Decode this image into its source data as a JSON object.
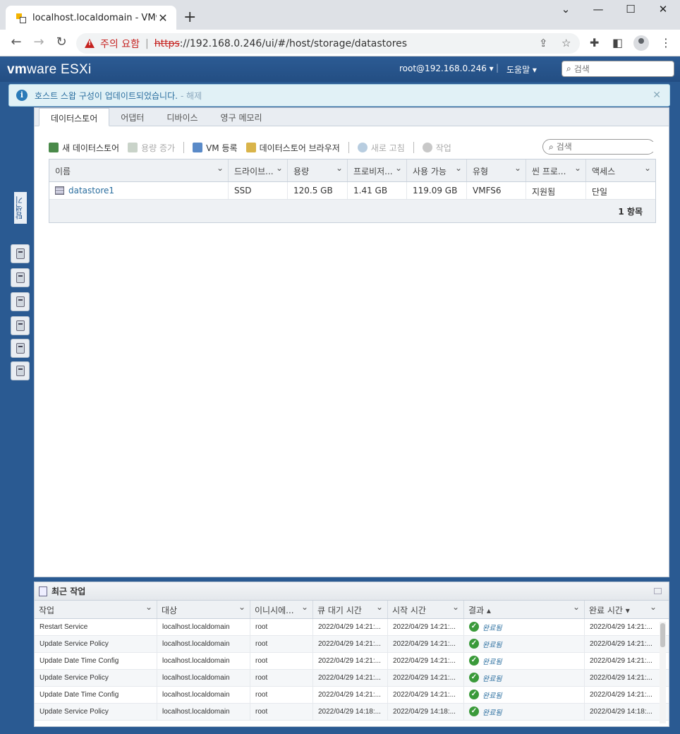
{
  "browser": {
    "tab_title": "localhost.localdomain - VMware",
    "security_warning": "주의 요함",
    "url_protocol": "https",
    "url_rest": "://192.168.0.246/ui/#/host/storage/datastores"
  },
  "header": {
    "logo_vm": "vm",
    "logo_ware": "ware",
    "logo_esxi": "ESXi",
    "user": "root@192.168.0.246 ▾",
    "separator": "|",
    "help": "도움말 ▾",
    "search_placeholder": "검색"
  },
  "notice": {
    "text": "호스트 스왑 구성이 업데이트되었습니다.",
    "link": "- 해제"
  },
  "sidebar": {
    "navigator_label": "탐색기"
  },
  "tabs": [
    "데이터스토어",
    "어댑터",
    "디바이스",
    "영구 메모리"
  ],
  "actions": {
    "new_datastore": "새 데이터스토어",
    "increase_capacity": "용량 증가",
    "register_vm": "VM 등록",
    "datastore_browser": "데이터스토어 브라우저",
    "refresh": "새로 고침",
    "tasks": "작업",
    "search_placeholder": "검색"
  },
  "datastore_grid": {
    "columns": [
      "이름",
      "드라이브...",
      "용량",
      "프로비저...",
      "사용 가능",
      "유형",
      "씬 프로...",
      "액세스"
    ],
    "rows": [
      [
        "datastore1",
        "SSD",
        "120.5 GB",
        "1.41 GB",
        "119.09 GB",
        "VMFS6",
        "지원됨",
        "단일"
      ]
    ],
    "footer": "1 항목"
  },
  "recent_tasks": {
    "title": "최근 작업",
    "columns": [
      "작업",
      "대상",
      "이니시에...",
      "큐 대기 시간",
      "시작 시간",
      "결과 ▴",
      "완료 시간 ▾"
    ],
    "rows": [
      [
        "Restart Service",
        "localhost.localdomain",
        "root",
        "2022/04/29 14:21:...",
        "2022/04/29 14:21:...",
        "완료됨",
        "2022/04/29 14:21:..."
      ],
      [
        "Update Service Policy",
        "localhost.localdomain",
        "root",
        "2022/04/29 14:21:...",
        "2022/04/29 14:21:...",
        "완료됨",
        "2022/04/29 14:21:..."
      ],
      [
        "Update Date Time Config",
        "localhost.localdomain",
        "root",
        "2022/04/29 14:21:...",
        "2022/04/29 14:21:...",
        "완료됨",
        "2022/04/29 14:21:..."
      ],
      [
        "Update Service Policy",
        "localhost.localdomain",
        "root",
        "2022/04/29 14:21:...",
        "2022/04/29 14:21:...",
        "완료됨",
        "2022/04/29 14:21:..."
      ],
      [
        "Update Date Time Config",
        "localhost.localdomain",
        "root",
        "2022/04/29 14:21:...",
        "2022/04/29 14:21:...",
        "완료됨",
        "2022/04/29 14:21:..."
      ],
      [
        "Update Service Policy",
        "localhost.localdomain",
        "root",
        "2022/04/29 14:18:...",
        "2022/04/29 14:18:...",
        "완료됨",
        "2022/04/29 14:18:..."
      ]
    ]
  },
  "colors": {
    "header_blue": "#2c5b94",
    "link": "#2a6e9f",
    "success": "#3a9a3a",
    "warning": "#c5221f"
  }
}
